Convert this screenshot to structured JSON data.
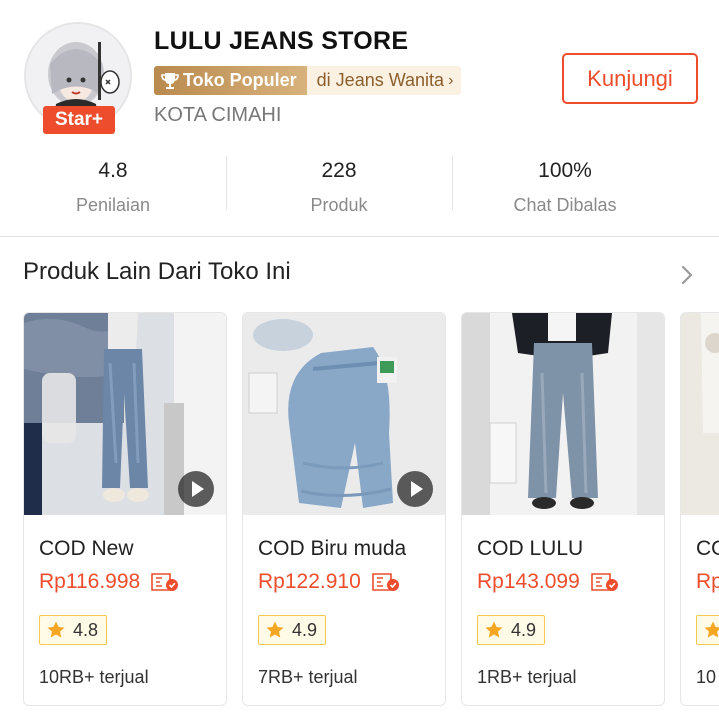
{
  "shop": {
    "name": "LULU JEANS STORE",
    "badge": "Star+",
    "popular_label": "Toko Populer",
    "category_label": "di Jeans Wanita",
    "location": "KOTA CIMAHI",
    "visit_label": "Kunjungi"
  },
  "stats": [
    {
      "value": "4.8",
      "label": "Penilaian"
    },
    {
      "value": "228",
      "label": "Produk"
    },
    {
      "value": "100%",
      "label": "Chat Dibalas"
    }
  ],
  "section": {
    "title": "Produk Lain Dari Toko Ini"
  },
  "products": [
    {
      "name": "COD New",
      "price": "Rp116.998",
      "rating": "4.8",
      "sold": "10RB+ terjual"
    },
    {
      "name": "COD Biru muda",
      "price": "Rp122.910",
      "rating": "4.9",
      "sold": "7RB+ terjual"
    },
    {
      "name": "COD LULU",
      "price": "Rp143.099",
      "rating": "4.9",
      "sold": "1RB+ terjual"
    },
    {
      "name": "CO",
      "price": "Rp",
      "sold": "10"
    }
  ],
  "colors": {
    "accent": "#ee4d2d",
    "gold": "#b98a4e",
    "rating_star": "#f5a623"
  }
}
